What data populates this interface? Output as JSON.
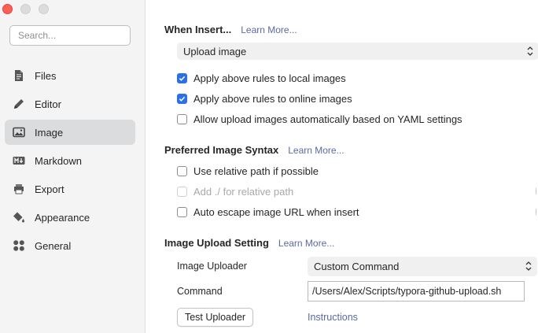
{
  "sidebar": {
    "search_placeholder": "Search...",
    "items": [
      {
        "label": "Files",
        "icon": "files-icon"
      },
      {
        "label": "Editor",
        "icon": "pencil-icon"
      },
      {
        "label": "Image",
        "icon": "image-icon",
        "active": true
      },
      {
        "label": "Markdown",
        "icon": "markdown-icon"
      },
      {
        "label": "Export",
        "icon": "export-icon"
      },
      {
        "label": "Appearance",
        "icon": "paint-bucket-icon"
      },
      {
        "label": "General",
        "icon": "grid-icon"
      }
    ]
  },
  "insert": {
    "title": "When Insert...",
    "learn_more": "Learn More...",
    "action": "Upload image",
    "options": [
      {
        "label": "Apply above rules to local images",
        "checked": true
      },
      {
        "label": "Apply above rules to online images",
        "checked": true
      },
      {
        "label": "Allow upload images automatically based on YAML settings",
        "checked": false
      }
    ]
  },
  "syntax": {
    "title": "Preferred Image Syntax",
    "learn_more": "Learn More...",
    "options": [
      {
        "label": "Use relative path if possible",
        "checked": false,
        "disabled": false
      },
      {
        "label": "Add ./ for relative path",
        "checked": false,
        "disabled": true
      },
      {
        "label": "Auto escape image URL when insert",
        "checked": false,
        "disabled": false
      }
    ]
  },
  "upload": {
    "title": "Image Upload Setting",
    "learn_more": "Learn More...",
    "uploader_label": "Image Uploader",
    "uploader_value": "Custom Command",
    "command_label": "Command",
    "command_value": "/Users/Alex/Scripts/typora-github-upload.sh",
    "test_button": "Test Uploader",
    "instructions_link": "Instructions"
  },
  "colors": {
    "accent": "#2a70e8",
    "link": "#5b6aa3",
    "sidebar_bg": "#f4f4f4",
    "active_item_bg": "#dadcde"
  }
}
